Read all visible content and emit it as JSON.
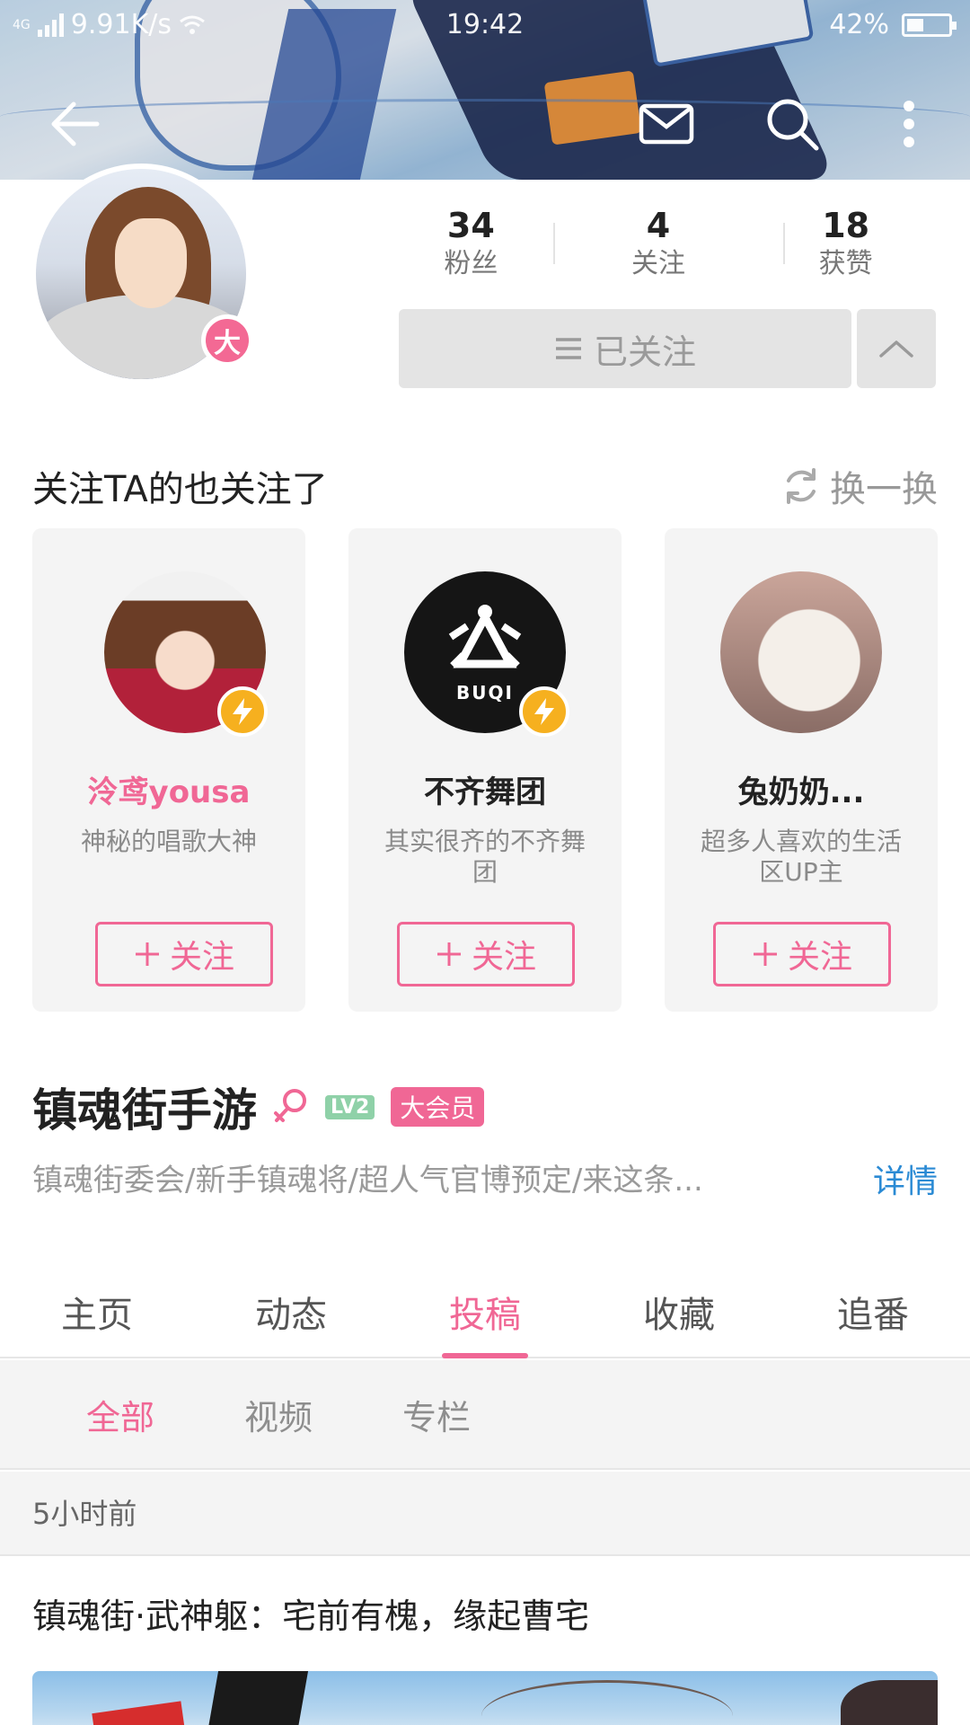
{
  "status_bar": {
    "network": "4G",
    "speed": "9.91K/s",
    "time": "19:42",
    "battery": "42%"
  },
  "nav_icons": [
    "back-arrow-icon",
    "mail-icon",
    "search-icon",
    "more-vertical-icon"
  ],
  "profile": {
    "avatar_badge": "大",
    "stats": [
      {
        "value": "34",
        "label": "粉丝"
      },
      {
        "value": "4",
        "label": "关注"
      },
      {
        "value": "18",
        "label": "获赞"
      }
    ],
    "follow_button": "已关注"
  },
  "recommend": {
    "title": "关注TA的也关注了",
    "refresh_label": "换一换",
    "cards": [
      {
        "name": "泠鸢yousa",
        "desc": "神秘的唱歌大神",
        "button": "关注",
        "verified": true
      },
      {
        "name": "不齐舞团",
        "desc": "其实很齐的不齐舞团",
        "button": "关注",
        "verified": true,
        "logo_text": "BUQI"
      },
      {
        "name": "兔奶奶...",
        "desc": "超多人喜欢的生活区UP主",
        "button": "关注",
        "verified": false
      }
    ]
  },
  "channel": {
    "name": "镇魂街手游",
    "level": "LV2",
    "vip": "大会员",
    "bio": "镇魂街委会/新手镇魂将/超人气官博预定/来这条...",
    "detail_link": "详情"
  },
  "tabs": [
    {
      "label": "主页",
      "active": false
    },
    {
      "label": "动态",
      "active": false
    },
    {
      "label": "投稿",
      "active": true
    },
    {
      "label": "收藏",
      "active": false
    },
    {
      "label": "追番",
      "active": false
    }
  ],
  "subtabs": [
    {
      "label": "全部",
      "active": true
    },
    {
      "label": "视频",
      "active": false
    },
    {
      "label": "专栏",
      "active": false
    }
  ],
  "post": {
    "time": "5小时前",
    "title": "镇魂街·武神躯：宅前有槐，缘起曹宅"
  },
  "colors": {
    "accent": "#f06795",
    "link": "#2a8ad4",
    "verified": "#f6b01f",
    "level": "#8fd1a8"
  }
}
